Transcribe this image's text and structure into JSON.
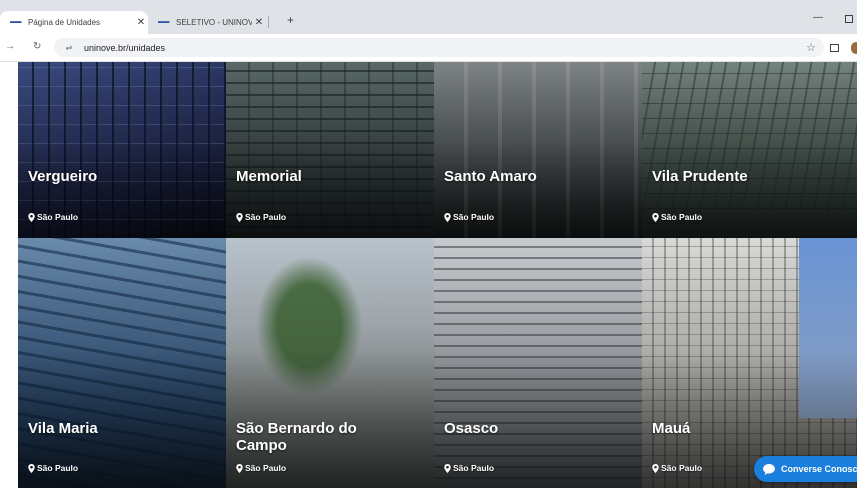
{
  "browser": {
    "tabs": [
      {
        "favicon": "uninove-logo",
        "title": "Página de Unidades",
        "active": true
      },
      {
        "favicon": "uninove-logo",
        "title": "SELETIVO - UNINOVE",
        "active": false
      }
    ],
    "address": {
      "url": "uninove.br/unidades"
    }
  },
  "units": [
    {
      "name": "Vergueiro",
      "location": "São Paulo"
    },
    {
      "name": "Memorial",
      "location": "São Paulo"
    },
    {
      "name": "Santo Amaro",
      "location": "São Paulo"
    },
    {
      "name": "Vila Prudente",
      "location": "São Paulo"
    },
    {
      "name": "Vila Maria",
      "location": "São Paulo"
    },
    {
      "name": "São Bernardo do Campo",
      "location": "São Paulo"
    },
    {
      "name": "Osasco",
      "location": "São Paulo"
    },
    {
      "name": "Mauá",
      "location": "São Paulo"
    }
  ],
  "chat": {
    "label": "Converse Conosco"
  },
  "icons": {
    "location": "map-pin-icon",
    "chat": "chat-bubble-icon"
  },
  "colors": {
    "chat_button": "#1a7fdc"
  }
}
